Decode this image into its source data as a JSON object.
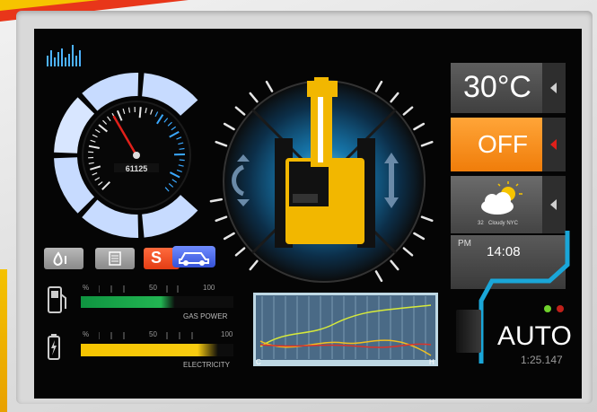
{
  "temperature": {
    "value": "30°C"
  },
  "power_toggle": {
    "label": "OFF"
  },
  "weather": {
    "temp": "32",
    "condition": "Cloudy NYC",
    "icon": "partly-cloudy-icon"
  },
  "clock": {
    "period": "PM",
    "time": "14:08"
  },
  "speedometer": {
    "odometer": "61125",
    "needle_level": 0.08
  },
  "gas_power": {
    "label": "GAS POWER",
    "percent_sign": "%",
    "mid": "50",
    "max": "100",
    "level": 0.62,
    "color": "#18a84a"
  },
  "electricity": {
    "label": "ELECTRICITY",
    "percent_sign": "%",
    "mid": "50",
    "max": "100",
    "level": 0.9,
    "color": "#f6c400"
  },
  "mode": {
    "label": "AUTO",
    "timer": "1:25.147"
  },
  "graph": {
    "x_start": "C",
    "x_end": "H"
  },
  "buttons": {
    "oil": "oil-drop-icon",
    "document": "document-icon",
    "s_label": "S",
    "car": "car-icon"
  },
  "colors": {
    "accent_orange": "#f58a1f",
    "accent_blue": "#1aa6d8",
    "gauge_ring": "#c7dbff",
    "status_green": "#6fd12c",
    "status_red": "#c0201a"
  }
}
